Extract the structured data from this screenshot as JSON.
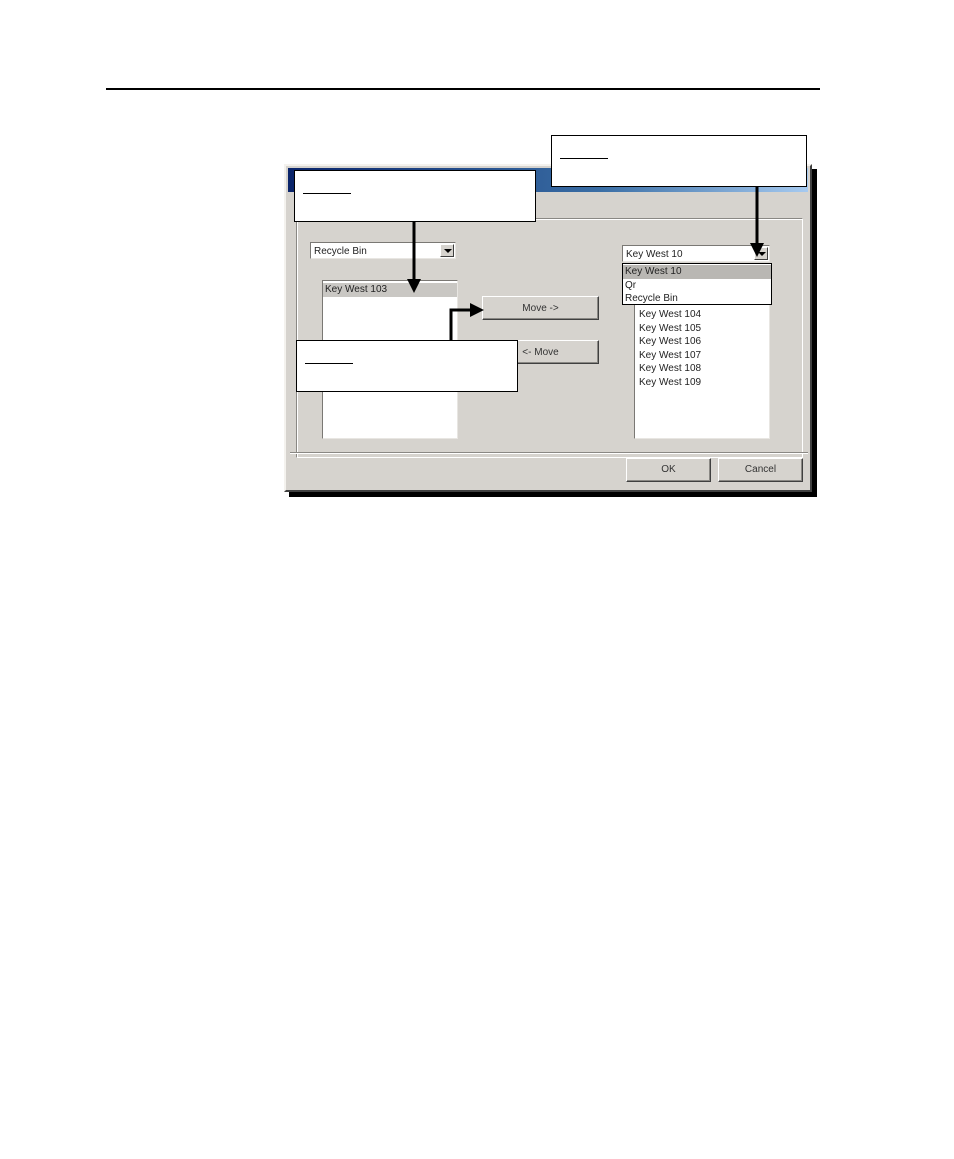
{
  "left_combo": {
    "value": "Recycle Bin"
  },
  "left_list": {
    "items": [
      "Key West 103"
    ],
    "selected_index": 0
  },
  "right_combo": {
    "value": "Key West 10"
  },
  "right_dropdown": {
    "items": [
      "Key West 10",
      "Qr",
      "Recycle Bin"
    ],
    "selected_index": 0
  },
  "right_list": {
    "items": [
      "Key West 104",
      "Key West 105",
      "Key West 106",
      "Key West 107",
      "Key West 108",
      "Key West 109"
    ]
  },
  "buttons": {
    "move_right": "Move ->",
    "move_left": "<- Move",
    "ok": "OK",
    "cancel": "Cancel"
  },
  "icons": [
    "chevron-down-icon"
  ]
}
